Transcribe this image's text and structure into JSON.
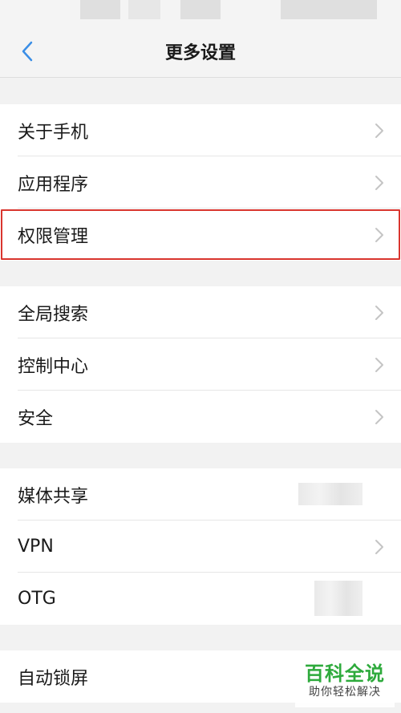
{
  "header": {
    "title": "更多设置",
    "back_icon": "chevron-left-icon",
    "accent_color": "#3a8ee6"
  },
  "groups": [
    {
      "items": [
        {
          "label": "关于手机",
          "icon": "chevron-right-icon"
        },
        {
          "label": "应用程序",
          "icon": "chevron-right-icon"
        },
        {
          "label": "权限管理",
          "icon": "chevron-right-icon",
          "highlighted": true
        }
      ]
    },
    {
      "items": [
        {
          "label": "全局搜索",
          "icon": "chevron-right-icon"
        },
        {
          "label": "控制中心",
          "icon": "chevron-right-icon"
        },
        {
          "label": "安全",
          "icon": "chevron-right-icon"
        }
      ]
    },
    {
      "items": [
        {
          "label": "媒体共享"
        },
        {
          "label": "VPN",
          "icon": "chevron-right-icon"
        },
        {
          "label": "OTG"
        }
      ]
    },
    {
      "items": [
        {
          "label": "自动锁屏"
        }
      ]
    }
  ],
  "highlight_color": "#d9352e",
  "watermark": {
    "main": "百科全说",
    "sub": "助你轻松解决",
    "color": "#2eaa3c"
  }
}
